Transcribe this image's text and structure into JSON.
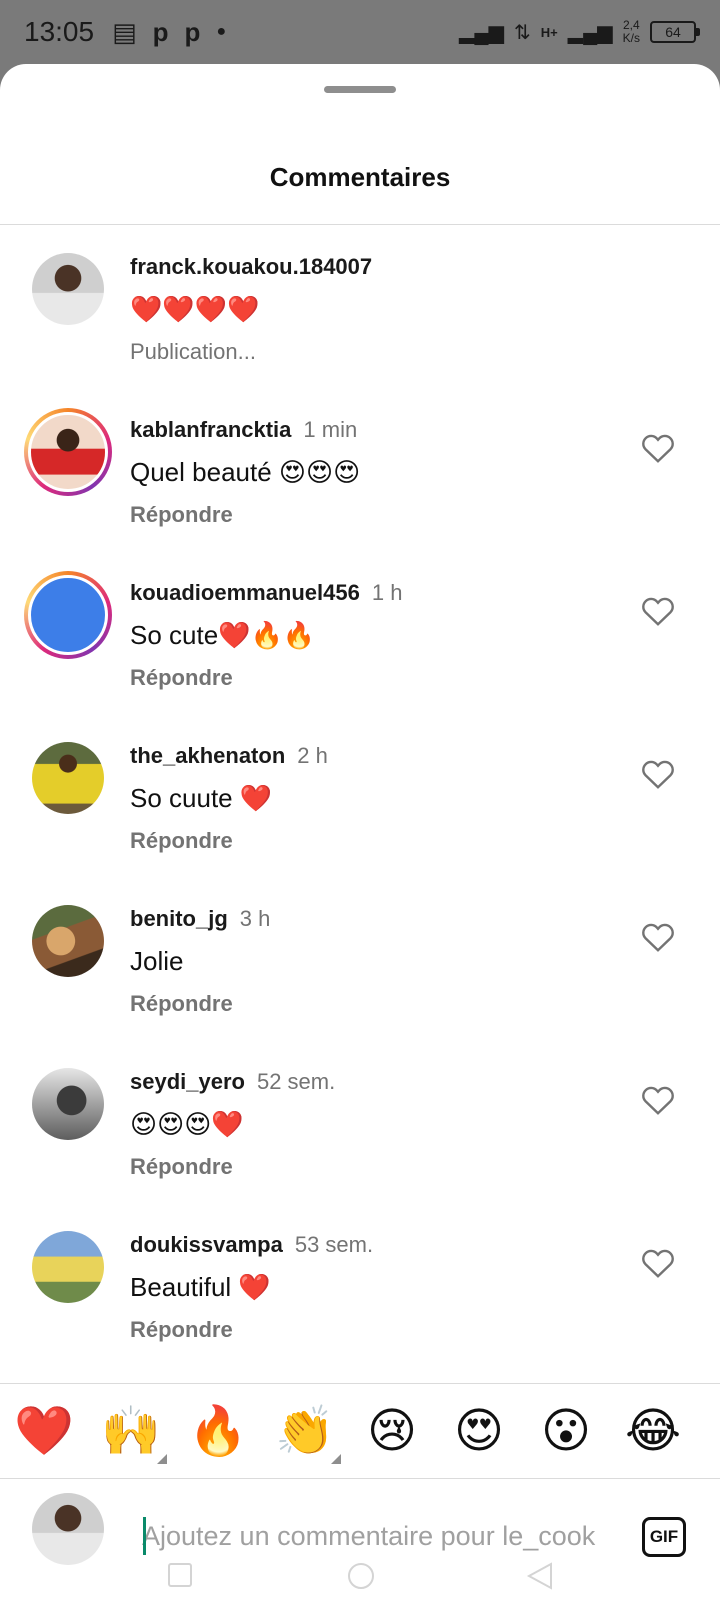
{
  "status_bar": {
    "time": "13:05",
    "icons": [
      "message-icon",
      "p-icon",
      "p-icon",
      "dot-icon"
    ],
    "network": "H+",
    "speed_value": "2,4",
    "speed_unit": "K/s",
    "battery": "64"
  },
  "sheet": {
    "title": "Commentaires"
  },
  "caption": {
    "username": "franck.kouakou.184007",
    "text": "❤️❤️❤️❤️",
    "action": "Publication..."
  },
  "comments": [
    {
      "username": "kablanfrancktia",
      "time": "1 min",
      "text": "Quel beauté 😍😍😍",
      "action": "Répondre"
    },
    {
      "username": "kouadioemmanuel456",
      "time": "1 h",
      "text": "So cute❤️🔥🔥",
      "action": "Répondre"
    },
    {
      "username": "the_akhenaton",
      "time": "2 h",
      "text": "So cuute ❤️",
      "action": "Répondre"
    },
    {
      "username": "benito_jg",
      "time": "3 h",
      "text": "Jolie",
      "action": "Répondre"
    },
    {
      "username": "seydi_yero",
      "time": "52 sem.",
      "text": "😍😍😍❤️",
      "action": "Répondre"
    },
    {
      "username": "doukissvampa",
      "time": "53 sem.",
      "text": "Beautiful ❤️",
      "action": "Répondre"
    }
  ],
  "reactions": [
    "❤️",
    "🙌",
    "🔥",
    "👏",
    "😢",
    "😍",
    "😮",
    "😂"
  ],
  "composer": {
    "placeholder": "Ajoutez un commentaire pour le_cook",
    "gif_label": "GIF"
  },
  "icons": {
    "like": "heart-outline-icon",
    "nav_recent": "square-icon",
    "nav_home": "circle-icon",
    "nav_back": "triangle-back-icon"
  }
}
